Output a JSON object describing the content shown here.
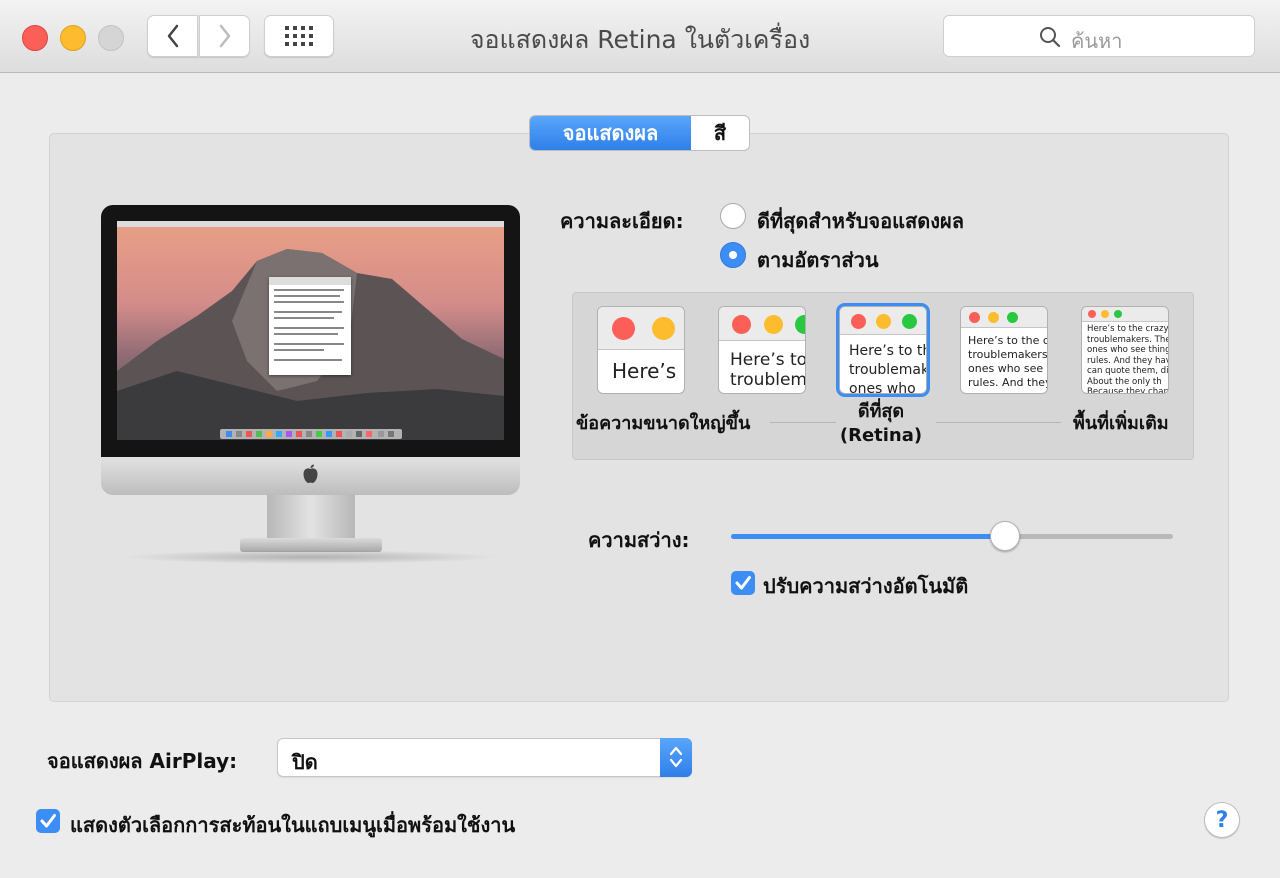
{
  "window": {
    "title": "จอแสดงผล Retina ในตัวเครื่อง"
  },
  "toolbar": {
    "search_placeholder": "ค้นหา",
    "back_glyph": "‹",
    "forward_glyph": "›"
  },
  "tabs": [
    {
      "label": "จอแสดงผล",
      "selected": true
    },
    {
      "label": "สี",
      "selected": false
    }
  ],
  "resolution": {
    "label": "ความละเอียด:",
    "options": [
      {
        "label": "ดีที่สุดสำหรับจอแสดงผล",
        "selected": false
      },
      {
        "label": "ตามอัตราส่วน",
        "selected": true
      }
    ],
    "scaled_left_label": "ข้อความขนาดใหญ่ขึ้น",
    "scaled_middle_label_line1": "ดีที่สุด",
    "scaled_middle_label_line2": "(Retina)",
    "scaled_right_label": "พื้นที่เพิ่มเติม",
    "thumbnails": [
      {
        "text": "Here’s"
      },
      {
        "text": "Here’s to\ntroublem"
      },
      {
        "text": "Here’s to th\ntroublemak\nones who"
      },
      {
        "text": "Here’s to the cr\ntroublemakers.\nones who see t\nrules. And they"
      },
      {
        "text": "Here’s to the crazy one\ntroublemakers. The rou\nones who see things dif\nrules. And they have no\ncan quote them, disagr\nAbout the only th\nBecause they change t"
      }
    ],
    "selected_index": 2
  },
  "brightness": {
    "label": "ความสว่าง:",
    "value": 0.62,
    "auto_label": "ปรับความสว่างอัตโนมัติ",
    "auto_checked": true
  },
  "airplay": {
    "label": "จอแสดงผล AirPlay:",
    "value": "ปิด"
  },
  "mirroring": {
    "label": "แสดงตัวเลือกการสะท้อนในแถบเมนูเมื่อพร้อมใช้งาน",
    "checked": true
  },
  "help": {
    "glyph": "?"
  },
  "colors": {
    "accent": "#3d8ef4",
    "close": "#fc5f57",
    "minimize": "#fdbc2e",
    "disabled": "#d5d5d5"
  }
}
